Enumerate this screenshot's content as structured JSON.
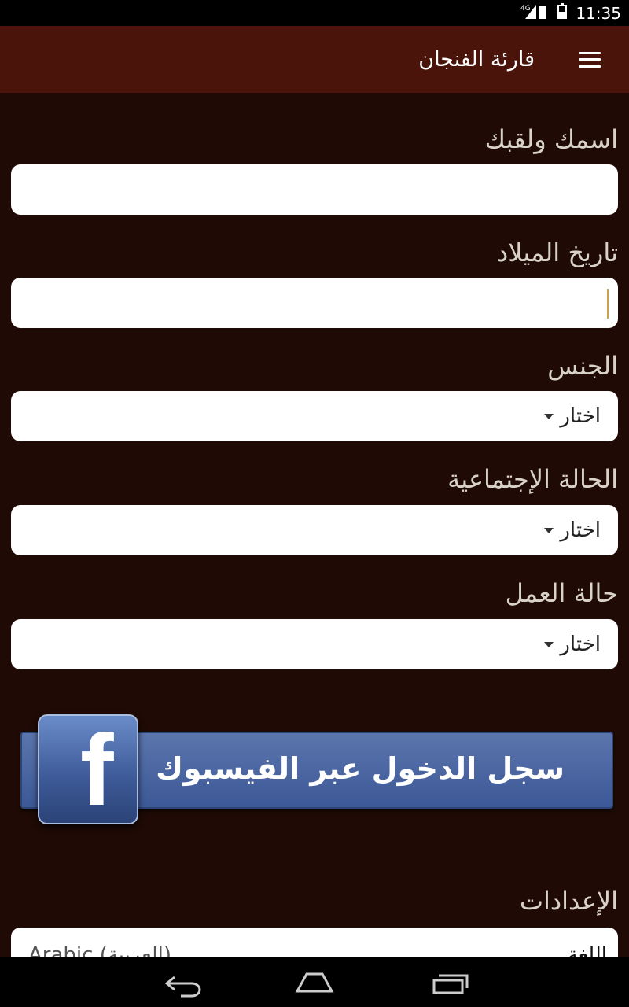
{
  "status_bar": {
    "network": "4G",
    "time": "11:35"
  },
  "app_bar": {
    "title": "قارئة الفنجان",
    "menu_icon": "hamburger-menu-icon"
  },
  "form": {
    "name_label": "اسمك ولقبك",
    "name_value": "",
    "birthdate_label": "تاريخ الميلاد",
    "birthdate_value": "",
    "gender_label": "الجنس",
    "gender_value": "اختار",
    "marital_label": "الحالة الإجتماعية",
    "marital_value": "اختار",
    "work_label": "حالة العمل",
    "work_value": "اختار"
  },
  "facebook_button": {
    "label": "سجل الدخول عبر الفيسبوك",
    "logo_letter": "f"
  },
  "settings": {
    "title": "الإعدادات",
    "language_key": "اللغة",
    "language_value": "Arabic (العربية)"
  },
  "colors": {
    "background": "#1f0a05",
    "app_bar": "#4a140a",
    "facebook_blue": "#3c5896"
  }
}
